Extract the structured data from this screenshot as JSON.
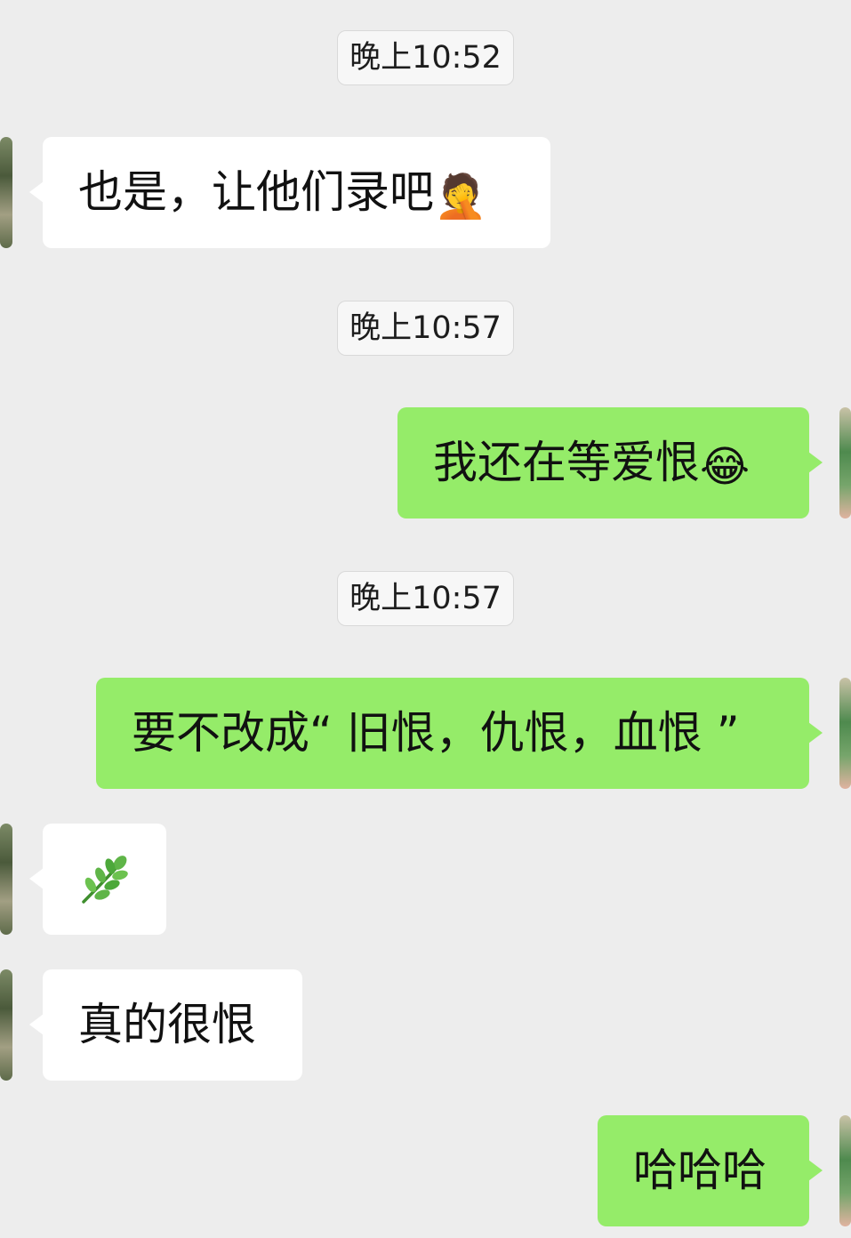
{
  "chat": {
    "timestamps": [
      "晚上10:52",
      "晚上10:57",
      "晚上10:57"
    ],
    "messages": [
      {
        "direction": "in",
        "text": "也是，让他们录吧",
        "emoji": "🤦"
      },
      {
        "direction": "out",
        "text": "我还在等爱恨",
        "emoji": "😂"
      },
      {
        "direction": "out",
        "text": "要不改成“ 旧恨，仇恨，血恨 ”"
      },
      {
        "direction": "in",
        "icon": "herb-emoji"
      },
      {
        "direction": "in",
        "text": "真的很恨"
      },
      {
        "direction": "out",
        "text": "哈哈哈"
      }
    ]
  },
  "colors": {
    "background": "#ededed",
    "incoming_bubble": "#ffffff",
    "outgoing_bubble": "#95ec69",
    "timestamp_bg": "#f7f7f7"
  }
}
